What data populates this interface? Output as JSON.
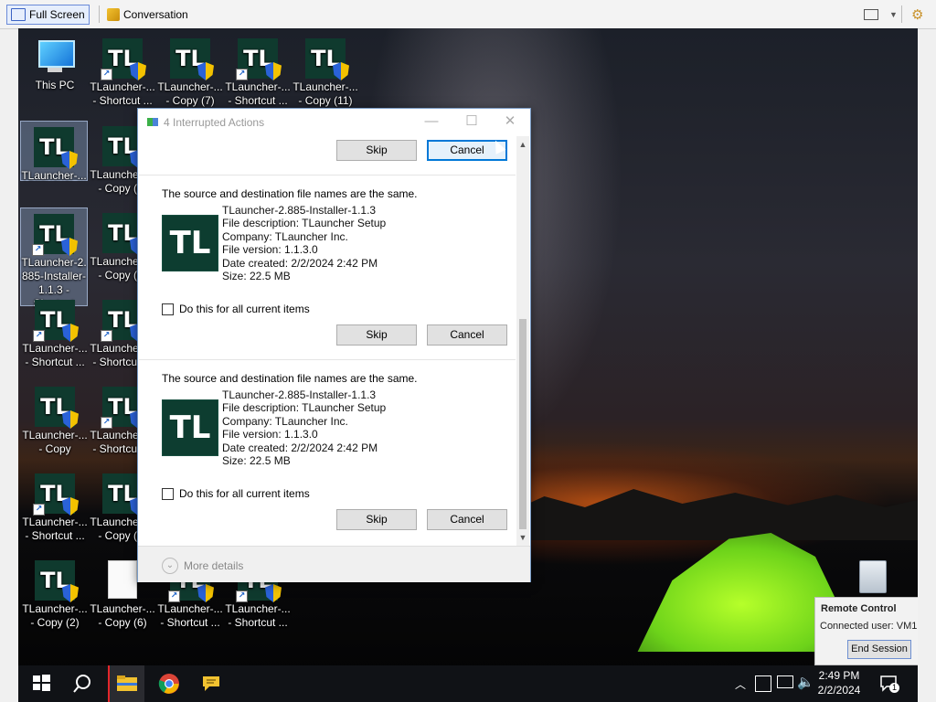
{
  "toolbar": {
    "full_screen_label": "Full Screen",
    "conversation_label": "Conversation"
  },
  "desktop_icons": [
    {
      "label": "This PC"
    },
    {
      "label": "TLauncher-...\n- Shortcut ..."
    },
    {
      "label": "TLauncher-...\n- Copy (7)"
    },
    {
      "label": "TLauncher-...\n- Shortcut ..."
    },
    {
      "label": "TLauncher-...\n- Copy (11)"
    },
    {
      "label": "TLauncher-..."
    },
    {
      "label": "TLauncher-...\n- Copy (3)"
    },
    {
      "label": "TLauncher-2.\n885-Installer-\n1.1.3 -\nShortcut"
    },
    {
      "label": "TLauncher-...\n- Copy (4)"
    },
    {
      "label": "TLauncher-...\n- Shortcut ..."
    },
    {
      "label": "TLauncher-...\n- Shortcut ..."
    },
    {
      "label": "TLauncher-...\n- Copy"
    },
    {
      "label": "TLauncher-...\n- Shortcut ..."
    },
    {
      "label": "TLauncher-...\n- Shortcut ..."
    },
    {
      "label": "TLauncher-...\n- Copy (5)"
    },
    {
      "label": "TLauncher-...\n- Copy (2)"
    },
    {
      "label": "TLauncher-...\n- Copy (6)"
    },
    {
      "label": "TLauncher-...\n- Shortcut ..."
    },
    {
      "label": "TLauncher-...\n- Shortcut ..."
    }
  ],
  "dialog": {
    "title": "4 Interrupted Actions",
    "top_skip": "Skip",
    "top_cancel": "Cancel",
    "items": [
      {
        "message": "The source and destination file names are the same.",
        "icon_text": "TL",
        "file_name": "TLauncher-2.885-Installer-1.1.3",
        "description": "File description: TLauncher Setup",
        "company": "Company: TLauncher Inc.",
        "version": "File version: 1.1.3.0",
        "date_created": "Date created: 2/2/2024 2:42 PM",
        "size": "Size: 22.5 MB",
        "checkbox_label": "Do this for all current items",
        "checked": false,
        "skip_label": "Skip",
        "cancel_label": "Cancel"
      },
      {
        "message": "The source and destination file names are the same.",
        "icon_text": "TL",
        "file_name": "TLauncher-2.885-Installer-1.1.3",
        "description": "File description: TLauncher Setup",
        "company": "Company: TLauncher Inc.",
        "version": "File version: 1.1.3.0",
        "date_created": "Date created: 2/2/2024 2:42 PM",
        "size": "Size: 22.5 MB",
        "checkbox_label": "Do this for all current items",
        "checked": false,
        "skip_label": "Skip",
        "cancel_label": "Cancel"
      }
    ],
    "more_details": "More details"
  },
  "taskbar": {
    "time": "2:49 PM",
    "date": "2/2/2024",
    "notification_count": "1"
  },
  "remote_panel": {
    "title": "Remote Control",
    "connected_user": "Connected user: VM1",
    "end_session": "End Session"
  },
  "colors": {
    "tlauncher_tile": "#0d3d30",
    "focus_blue": "#0078d7",
    "taskbar": "#101216"
  }
}
